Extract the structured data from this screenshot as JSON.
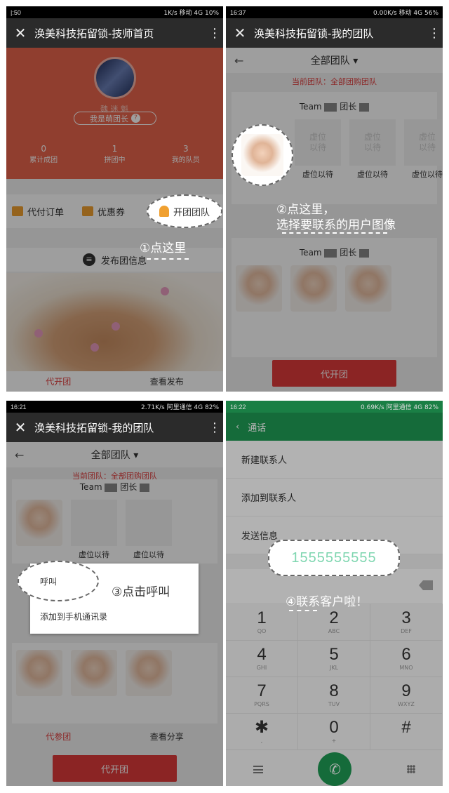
{
  "p1": {
    "status": {
      "left": "|:50",
      "right": "1K/s  移动 4G  10%"
    },
    "title": "涣美科技拓留锁-技师首页",
    "nickname": "魏 迷 魁",
    "leader_label": "我是萌团长",
    "help": "?",
    "stats": [
      {
        "num": "0",
        "label": "累计成团"
      },
      {
        "num": "1",
        "label": "拼团中"
      },
      {
        "num": "3",
        "label": "我的队员"
      }
    ],
    "menu": [
      "代付订单",
      "优惠券",
      "开团团队"
    ],
    "publish": "发布团信息",
    "note": "①点这里",
    "bottom": [
      "代开团",
      "查看发布"
    ]
  },
  "p2": {
    "status": {
      "left": "16:37",
      "right": "0.00K/s  移动 4G  56%"
    },
    "title": "涣美科技拓留锁-我的团队",
    "filter": "全部团队 ▾",
    "current": "当前团队：全部团购团队",
    "team_head": "Team",
    "leader": "团长",
    "slots": [
      "虚位以待",
      "虚位以待",
      "虚位以待"
    ],
    "placeholder": "虚位\n以待",
    "note_line1": "②点这里，",
    "note_line2": "选择要联系的用户图像",
    "button": "代开团"
  },
  "p3": {
    "status": {
      "left": "16:21",
      "right": "2.71K/s  阿里通信 4G  82%"
    },
    "title": "涣美科技拓留锁-我的团队",
    "filter": "全部团队 ▾",
    "current": "当前团队：全部团购团队",
    "team_head": "Team",
    "leader": "团长",
    "slots": [
      "虚位以待",
      "虚位以待",
      "虚位以待"
    ],
    "popup": [
      "呼叫",
      "添加到手机通讯录"
    ],
    "note": "③点击呼叫",
    "bottom": [
      "代参团",
      "查看分享"
    ],
    "button": "代开团",
    "side_slot": "虚位"
  },
  "p4": {
    "status": {
      "left": "16:22",
      "right": "0.69K/s  阿里通信 4G  82%"
    },
    "title": "通话",
    "list": [
      "新建联系人",
      "添加到联系人",
      "发送信息"
    ],
    "number": "1555555555",
    "note": "④联系客户啦！",
    "keys": [
      {
        "d": "1",
        "s": "QO"
      },
      {
        "d": "2",
        "s": "ABC"
      },
      {
        "d": "3",
        "s": "DEF"
      },
      {
        "d": "4",
        "s": "GHI"
      },
      {
        "d": "5",
        "s": "JKL"
      },
      {
        "d": "6",
        "s": "MNO"
      },
      {
        "d": "7",
        "s": "PQRS"
      },
      {
        "d": "8",
        "s": "TUV"
      },
      {
        "d": "9",
        "s": "WXYZ"
      },
      {
        "d": "✱",
        "s": ","
      },
      {
        "d": "0",
        "s": "+"
      },
      {
        "d": "#",
        "s": ""
      }
    ]
  },
  "colors": {
    "accent_red": "#e03a3a",
    "hero": "#e8644c",
    "green": "#1f9a54"
  }
}
